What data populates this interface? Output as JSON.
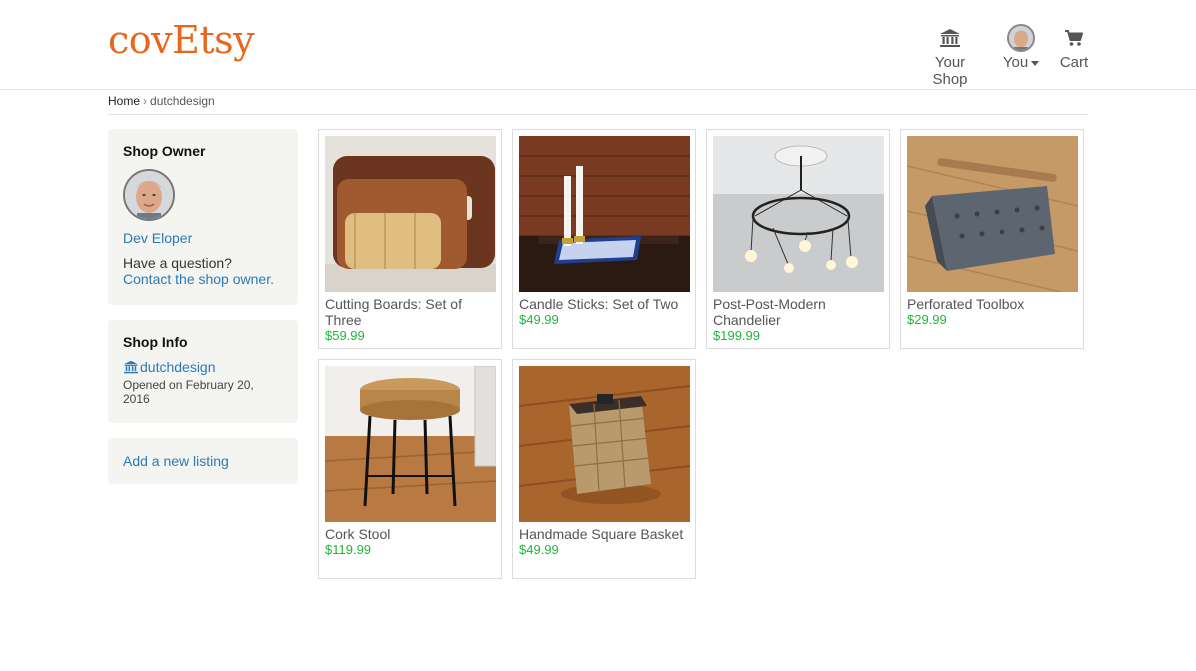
{
  "header": {
    "logo": "covEtsy",
    "nav": {
      "shop_label": "Your Shop",
      "you_label": "You",
      "cart_label": "Cart"
    }
  },
  "breadcrumb": {
    "home": "Home",
    "separator": "›",
    "current": "dutchdesign"
  },
  "sidebar": {
    "owner": {
      "heading": "Shop Owner",
      "name": "Dev Eloper",
      "question": "Have a question?",
      "contact": "Contact the shop owner."
    },
    "info": {
      "heading": "Shop Info",
      "shop_name": "dutchdesign",
      "opened": "Opened on February 20, 2016"
    },
    "add_listing": "Add a new listing"
  },
  "listings": [
    {
      "title": "Cutting Boards: Set of Three",
      "price": "$59.99"
    },
    {
      "title": "Candle Sticks: Set of Two",
      "price": "$49.99"
    },
    {
      "title": "Post-Post-Modern Chandelier",
      "price": "$199.99"
    },
    {
      "title": "Perforated Toolbox",
      "price": "$29.99"
    },
    {
      "title": "Cork Stool",
      "price": "$119.99"
    },
    {
      "title": "Handmade Square Basket",
      "price": "$49.99"
    }
  ],
  "colors": {
    "brand": "#e8671c",
    "link": "#2a7ab6",
    "price": "#22b53b",
    "panel": "#f4f4f1"
  },
  "icons": [
    "bank-icon",
    "cart-icon",
    "avatar"
  ]
}
